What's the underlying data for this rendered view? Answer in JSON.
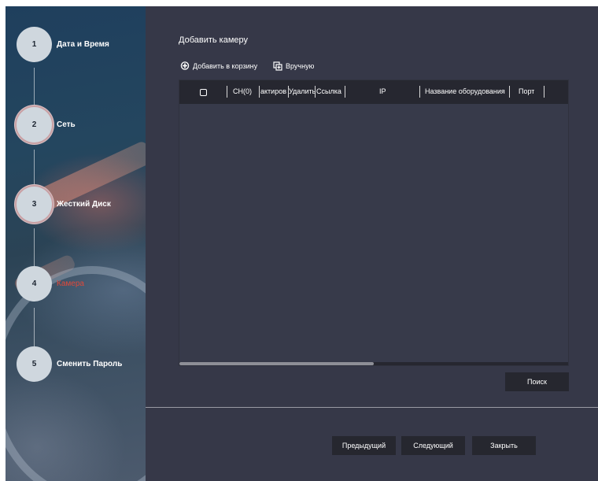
{
  "sidebar": {
    "steps": [
      {
        "num": "1",
        "label": "Дата и Время"
      },
      {
        "num": "2",
        "label": "Сеть"
      },
      {
        "num": "3",
        "label": "Жесткий Диск"
      },
      {
        "num": "4",
        "label": "Камера",
        "active": true
      },
      {
        "num": "5",
        "label": "Сменить Пароль"
      }
    ]
  },
  "main": {
    "title": "Добавить камеру",
    "toolbar": {
      "add_to_cart_label": "Добавить в корзину",
      "add_to_cart_icon": "camera-plus-icon",
      "manual_label": "Вручную",
      "manual_icon": "manual-add-icon"
    },
    "table": {
      "columns": [
        "CH(0)",
        "активатор",
        "Удалить",
        "Ссылка",
        "IP",
        "Название оборудования",
        "Порт"
      ],
      "columns_display": [
        "CH(0)",
        "актиров",
        "Удалить",
        "Ссылка",
        "IP",
        "Название оборудования",
        "Порт"
      ],
      "rows": [],
      "scroll_fraction": 0.5
    },
    "search_label": "Поиск"
  },
  "footer": {
    "prev_label": "Предыдущий",
    "next_label": "Следующий",
    "close_label": "Закрыть"
  },
  "colors": {
    "background": "#363848",
    "header": "#262730",
    "button": "#26272f",
    "active_step": "#e0493a"
  }
}
